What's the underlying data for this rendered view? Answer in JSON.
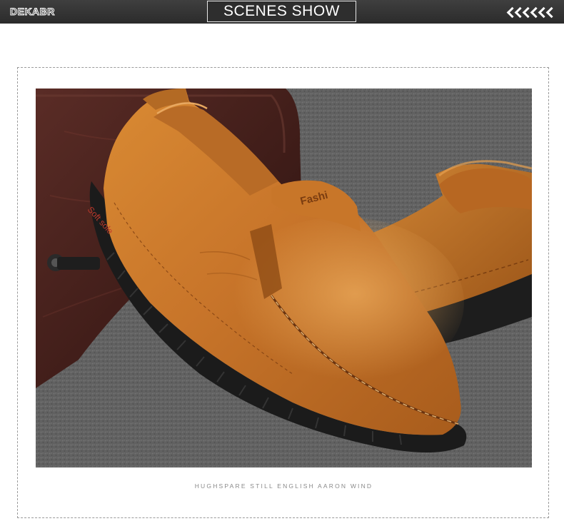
{
  "banner": {
    "brand": "DEKABR",
    "title": "SCENES SHOW",
    "chevron_count": 6
  },
  "photo": {
    "shoe_logo_text": "Fashi",
    "sole_text": "Soft sole",
    "caption": "HUGHSPARE STILL ENGLISH AARON WIND"
  },
  "colors": {
    "banner_bg": "#2f2f2f",
    "leather": "#c9782a",
    "sole": "#1a1a1a",
    "carpet": "#6e6e6e",
    "bag": "#4a2420"
  }
}
